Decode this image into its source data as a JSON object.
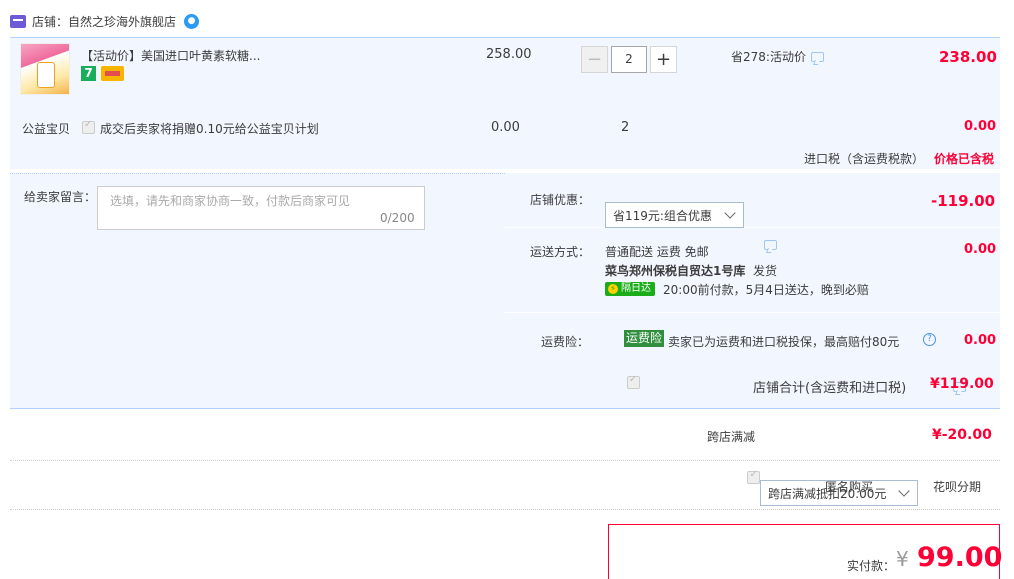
{
  "shop": {
    "label": "店铺：自然之珍海外旗舰店"
  },
  "item": {
    "title": "【活动价】美国进口叶黄素软糖...",
    "badge_number": "7",
    "unit_price": "258.00",
    "quantity": "2",
    "minus": "−",
    "plus": "+",
    "promo": "省278:活动价",
    "total": "238.00"
  },
  "charity": {
    "label": "公益宝贝",
    "text": "成交后卖家将捐赠0.10元给公益宝贝计划",
    "price": "0.00",
    "qty": "2",
    "total": "0.00"
  },
  "tax": {
    "label": "进口税（含运费税款）",
    "value": "价格已含税"
  },
  "message": {
    "label": "给卖家留言：",
    "placeholder": "选填，请先和商家协商一致，付款后商家可见",
    "count": "0/200"
  },
  "shop_discount": {
    "label": "店铺优惠：",
    "selected": "省119元:组合优惠",
    "amount": "-119.00"
  },
  "shipping": {
    "label": "运送方式：",
    "line1": "普通配送 运费 免邮",
    "warehouse": "菜鸟郑州保税自贸达1号库",
    "dispatch": "发货",
    "badge": "隔日达",
    "line3": "20:00前付款，5月4日送达，晚到必赔",
    "amount": "0.00"
  },
  "insurance": {
    "label": "运费险：",
    "tag": "运费险",
    "text": "卖家已为运费和进口税投保，最高赔付80元",
    "amount": "0.00",
    "help": "?"
  },
  "shop_total": {
    "label": "店铺合计(含运费和进口税)",
    "amount": "¥119.00"
  },
  "cross_store": {
    "label": "跨店满减",
    "selected": "跨店满减抵扣20.00元",
    "amount": "¥-20.00"
  },
  "options": {
    "anonymous": "匿名购买",
    "huabei": "花呗分期"
  },
  "payment": {
    "label": "实付款：",
    "currency": "¥",
    "amount": "99.00"
  },
  "colors": {
    "accent": "#ff0036",
    "panel": "#f2f7ff",
    "border": "#b2d1ff"
  }
}
